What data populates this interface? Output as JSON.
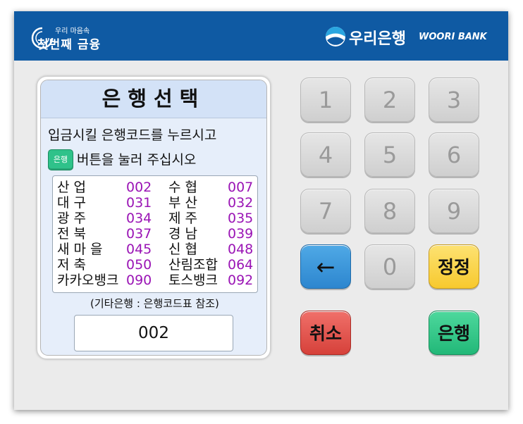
{
  "header": {
    "slogan_small": "우리 마음속",
    "slogan_big": "첫번째 금융",
    "brand_name": "우리은행",
    "brand_en": "WOORI BANK"
  },
  "panel": {
    "title": "은행선택",
    "instruction_line1": "입금시킬 은행코드를 누르시고",
    "bank_button_label": "은행",
    "instruction_line2": "버튼을 눌러 주십시오",
    "banks": [
      {
        "left_name": "산        업",
        "left_code": "002",
        "right_name": "수        협",
        "right_code": "007"
      },
      {
        "left_name": "대        구",
        "left_code": "031",
        "right_name": "부        산",
        "right_code": "032"
      },
      {
        "left_name": "광        주",
        "left_code": "034",
        "right_name": "제        주",
        "right_code": "035"
      },
      {
        "left_name": "전        북",
        "left_code": "037",
        "right_name": "경        남",
        "right_code": "039"
      },
      {
        "left_name": "새  마  을",
        "left_code": "045",
        "right_name": "신        협",
        "right_code": "048"
      },
      {
        "left_name": "저        축",
        "left_code": "050",
        "right_name": "산림조합",
        "right_code": "064"
      },
      {
        "left_name": "카카오뱅크",
        "left_code": "090",
        "right_name": "토스뱅크",
        "right_code": "092"
      }
    ],
    "note": "(기타은행 : 은행코드표 참조)",
    "input_value": "002"
  },
  "keypad": {
    "k1": "1",
    "k2": "2",
    "k3": "3",
    "k4": "4",
    "k5": "5",
    "k6": "6",
    "k7": "7",
    "k8": "8",
    "k9": "9",
    "k0": "0",
    "back": "←",
    "correct": "정정",
    "cancel": "취소",
    "bank": "은행"
  },
  "colors": {
    "header_bg": "#0f5aa3",
    "code_color": "#9a14b5",
    "back_key": "#2d86cf",
    "correct_key": "#f7c92e",
    "cancel_key": "#d6413a",
    "bank_key": "#22b878"
  }
}
